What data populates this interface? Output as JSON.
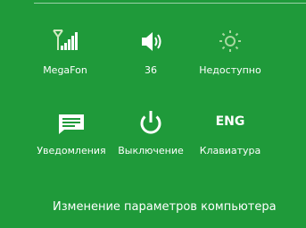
{
  "settings_panel": {
    "tiles": [
      {
        "id": "network",
        "label": "MegaFon",
        "icon": "signal-bars-icon",
        "icon_color": "#cfe8bf"
      },
      {
        "id": "volume",
        "label": "36",
        "icon": "speaker-volume-icon",
        "icon_color": "#ffffff"
      },
      {
        "id": "brightness",
        "label": "Недоступно",
        "icon": "brightness-sun-icon",
        "icon_color": "#a8d8a0"
      },
      {
        "id": "notifications",
        "label": "Уведомления",
        "icon": "notifications-icon",
        "icon_color": "#ffffff"
      },
      {
        "id": "power",
        "label": "Выключение",
        "icon": "power-icon",
        "icon_color": "#ffffff"
      },
      {
        "id": "keyboard",
        "label": "Клавиатура",
        "icon_text": "ENG",
        "icon": "keyboard-language-icon"
      }
    ],
    "change_pc_settings": "Изменение параметров компьютера"
  },
  "colors": {
    "background": "#1f9a3a",
    "text": "#ffffff",
    "dim_icon": "#a8d8a0"
  }
}
